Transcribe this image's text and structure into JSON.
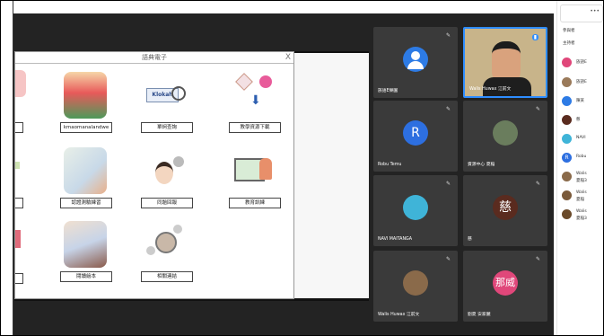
{
  "slide": {
    "title": "語典電子",
    "close": "X",
    "apps": [
      {
        "label": "kmaomanalandwe"
      },
      {
        "label": "單詞查詢"
      },
      {
        "label": "教學資源下載"
      },
      {
        "label": "認證測驗練習"
      },
      {
        "label": "同題回報"
      },
      {
        "label": "教育訓練"
      },
      {
        "label": "閱讀繪本"
      },
      {
        "label": "相關連結"
      }
    ],
    "klokah_text": "Klokah"
  },
  "tiles": [
    {
      "name": "族語E樂園",
      "initial": "",
      "color": "#2d7be5"
    },
    {
      "name": "Walis Huwax 江前文",
      "initial": "",
      "color": "#8a6a4a"
    },
    {
      "name": "Robu Temu",
      "initial": "R",
      "color": "#2d6fe0"
    },
    {
      "name": "資源中心 夏稲",
      "initial": "",
      "color": "#6a7d5d"
    },
    {
      "name": "NAVI MAITANGA",
      "initial": "",
      "color": "#3fb4d8"
    },
    {
      "name": "慈",
      "initial": "慈",
      "color": "#5a2b1f"
    },
    {
      "name": "Walis Huwax 江前文",
      "initial": "",
      "color": "#8a6a4a"
    },
    {
      "name": "劉夏 安家麗",
      "initial": "那威",
      "color": "#e0477a"
    }
  ],
  "panel": {
    "header1": "參與者",
    "header2": "主持者",
    "rows": [
      {
        "name": "族語E",
        "name2": "",
        "initial": "",
        "color": "#e0477a"
      },
      {
        "name": "族語E",
        "name2": "",
        "initial": "",
        "color": "#9a7a5a"
      },
      {
        "name": "陳某",
        "name2": "",
        "initial": "",
        "color": "#2d7be5"
      },
      {
        "name": "慈",
        "name2": "",
        "initial": "",
        "color": "#5a2b1f"
      },
      {
        "name": "NAVI",
        "name2": "",
        "initial": "",
        "color": "#3fb4d8"
      },
      {
        "name": "Robu",
        "name2": "",
        "initial": "R",
        "color": "#2d6fe0"
      },
      {
        "name": "Walis",
        "name2": "夏稲3",
        "initial": "",
        "color": "#8a6a4a"
      },
      {
        "name": "Walis",
        "name2": "夏稲",
        "initial": "",
        "color": "#7a5a3a"
      },
      {
        "name": "Walis",
        "name2": "夏稲3",
        "initial": "",
        "color": "#6a4a2a"
      }
    ]
  }
}
